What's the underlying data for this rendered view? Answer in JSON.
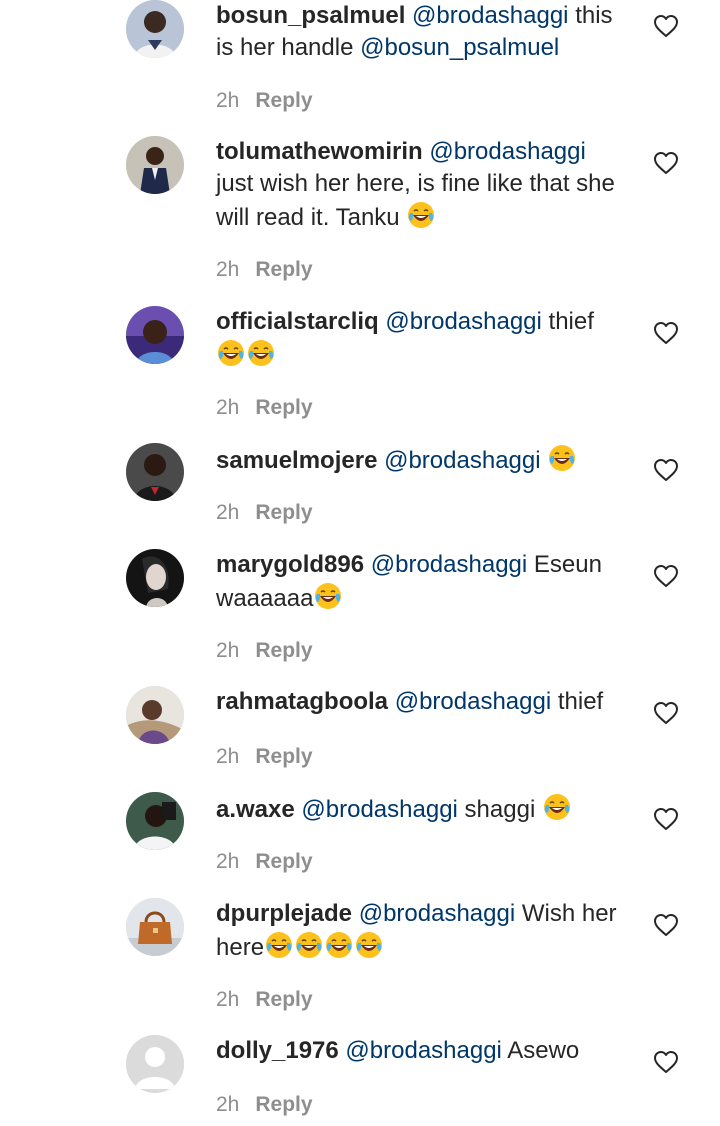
{
  "comments": [
    {
      "username": "bosun_psalmuel",
      "mention": "@brodashaggi",
      "text": "this is her handle",
      "mention2": "@bosun_psalmuel",
      "emoji_count": 0,
      "time": "2h",
      "reply_label": "Reply",
      "avatar_color": "#3b4a6b"
    },
    {
      "username": "tolumathewomirin",
      "mention": "@brodashaggi",
      "text": "just wish her here, is fine like that she will read it. Tanku",
      "emoji_count": 1,
      "time": "2h",
      "reply_label": "Reply",
      "avatar_color": "#2a2f45"
    },
    {
      "username": "officialstarcliq",
      "mention": "@brodashaggi",
      "text": "thief",
      "emoji_count": 2,
      "time": "2h",
      "reply_label": "Reply",
      "avatar_color": "#5a3a8a"
    },
    {
      "username": "samuelmojere",
      "mention": "@brodashaggi",
      "text": "",
      "emoji_count": 1,
      "time": "2h",
      "reply_label": "Reply",
      "avatar_color": "#2b2b2b"
    },
    {
      "username": "marygold896",
      "mention": "@brodashaggi",
      "text": "Eseun waaaaaa",
      "emoji_count": 1,
      "time": "2h",
      "reply_label": "Reply",
      "avatar_color": "#1e1e1e"
    },
    {
      "username": "rahmatagboola",
      "mention": "@brodashaggi",
      "text": "thief",
      "emoji_count": 0,
      "time": "2h",
      "reply_label": "Reply",
      "avatar_color": "#8b6b5a"
    },
    {
      "username": "a.waxe",
      "mention": "@brodashaggi",
      "text": "shaggi",
      "emoji_count": 1,
      "time": "2h",
      "reply_label": "Reply",
      "avatar_color": "#2a3b34"
    },
    {
      "username": "dpurplejade",
      "mention": "@brodashaggi",
      "text": "Wish her here",
      "emoji_count": 4,
      "time": "2h",
      "reply_label": "Reply",
      "avatar_color": "#b5793a"
    },
    {
      "username": "dolly_1976",
      "mention": "@brodashaggi",
      "text": "Asewo",
      "emoji_count": 0,
      "time": "2h",
      "reply_label": "Reply",
      "avatar_color": "#dbdbdb"
    }
  ],
  "icons": {
    "like": "heart-outline-icon",
    "emoji": "face-with-tears-of-joy-icon",
    "default_avatar": "default-avatar-icon"
  },
  "colors": {
    "username": "#262626",
    "mention": "#00376b",
    "meta": "#8e8e8e",
    "background": "#ffffff"
  }
}
